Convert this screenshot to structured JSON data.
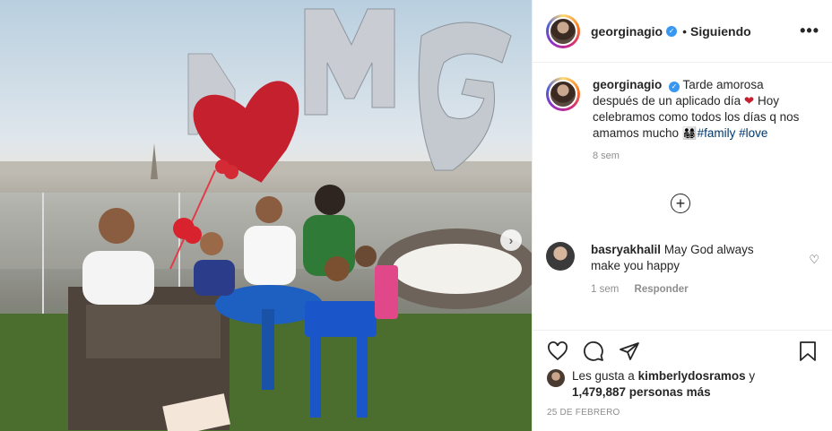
{
  "post": {
    "username": "georginagio",
    "verified_badge": "✓",
    "separator": "•",
    "follow_status": "Siguiendo",
    "more_icon": "more-horizontal-icon"
  },
  "caption": {
    "username": "georginagio",
    "text_1": "Tarde amorosa después de un aplicado día",
    "emoji_heart": "❤",
    "text_2": "Hoy celebramos como todos los días q nos amamos mucho",
    "emoji_family": "👨‍👩‍👧‍👦",
    "hashtag_1": "#family",
    "hashtag_2": "#love",
    "time": "8 sem"
  },
  "comment": {
    "username": "basryakhalil",
    "text": "May God always make you happy",
    "time": "1 sem",
    "reply_label": "Responder"
  },
  "likes": {
    "prefix": "Les gusta a",
    "user": "kimberlydosramos",
    "middle": "y",
    "count": "1,479,887 personas más"
  },
  "date": "25 DE FEBRERO",
  "photo": {
    "balloon_letters": [
      "M",
      "G"
    ],
    "next_icon": "chevron-right-icon"
  },
  "colors": {
    "link": "#00376b",
    "verified": "#3897f0",
    "muted": "#8e8e8e"
  }
}
